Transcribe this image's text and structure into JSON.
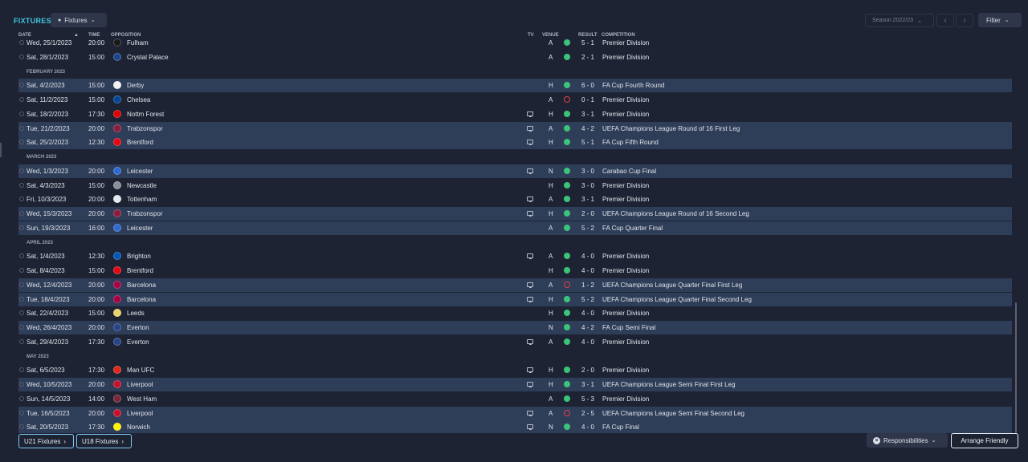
{
  "header": {
    "title": "FIXTURES",
    "view_label": "Fixtures",
    "season_label": "Season 2022/23",
    "filter_label": "Filter"
  },
  "columns": {
    "date": "DATE",
    "time": "TIME",
    "opposition": "OPPOSITION",
    "tv": "TV",
    "venue": "VENUE",
    "result": "RESULT",
    "competition": "COMPETITION"
  },
  "months": [
    "FEBRUARY 2023",
    "MARCH 2023",
    "APRIL 2023",
    "MAY 2023"
  ],
  "fixtures": [
    {
      "date": "Wed, 25/1/2023",
      "time": "20:00",
      "opposition": "Fulham",
      "tv": false,
      "venue": "A",
      "outcome": "win",
      "score": "5 - 1",
      "competition": "Premier Division",
      "crest_color": "#1b1b1b"
    },
    {
      "date": "Sat, 28/1/2023",
      "time": "15:00",
      "opposition": "Crystal Palace",
      "tv": false,
      "venue": "A",
      "outcome": "win",
      "score": "2 - 1",
      "competition": "Premier Division",
      "crest_color": "#1b458f"
    },
    {
      "date": "Sat, 4/2/2023",
      "time": "15:00",
      "opposition": "Derby",
      "tv": false,
      "venue": "H",
      "outcome": "win",
      "score": "6 - 0",
      "competition": "FA Cup Fourth Round",
      "crest_color": "#f2f2f2"
    },
    {
      "date": "Sat, 11/2/2023",
      "time": "15:00",
      "opposition": "Chelsea",
      "tv": false,
      "venue": "A",
      "outcome": "loss",
      "score": "0 - 1",
      "competition": "Premier Division",
      "crest_color": "#034694"
    },
    {
      "date": "Sat, 18/2/2023",
      "time": "17:30",
      "opposition": "Nottm Forest",
      "tv": true,
      "venue": "H",
      "outcome": "win",
      "score": "3 - 1",
      "competition": "Premier Division",
      "crest_color": "#dd0000"
    },
    {
      "date": "Tue, 21/2/2023",
      "time": "20:00",
      "opposition": "Trabzonspor",
      "tv": true,
      "venue": "A",
      "outcome": "win",
      "score": "4 - 2",
      "competition": "UEFA Champions League Round of 16 First Leg",
      "crest_color": "#8a1c3c"
    },
    {
      "date": "Sat, 25/2/2023",
      "time": "12:30",
      "opposition": "Brentford",
      "tv": true,
      "venue": "H",
      "outcome": "win",
      "score": "5 - 1",
      "competition": "FA Cup Fifth Round",
      "crest_color": "#e30613"
    },
    {
      "date": "Wed, 1/3/2023",
      "time": "20:00",
      "opposition": "Leicester",
      "tv": true,
      "venue": "N",
      "outcome": "win",
      "score": "3 - 0",
      "competition": "Carabao Cup Final",
      "crest_color": "#2f6ad0"
    },
    {
      "date": "Sat, 4/3/2023",
      "time": "15:00",
      "opposition": "Newcastle",
      "tv": false,
      "venue": "H",
      "outcome": "win",
      "score": "3 - 0",
      "competition": "Premier Division",
      "crest_color": "#8a8f99"
    },
    {
      "date": "Fri, 10/3/2023",
      "time": "20:00",
      "opposition": "Tottenham",
      "tv": true,
      "venue": "A",
      "outcome": "win",
      "score": "3 - 1",
      "competition": "Premier Division",
      "crest_color": "#e8e8f0"
    },
    {
      "date": "Wed, 15/3/2023",
      "time": "20:00",
      "opposition": "Trabzonspor",
      "tv": true,
      "venue": "H",
      "outcome": "win",
      "score": "2 - 0",
      "competition": "UEFA Champions League Round of 16 Second Leg",
      "crest_color": "#8a1c3c"
    },
    {
      "date": "Sun, 19/3/2023",
      "time": "16:00",
      "opposition": "Leicester",
      "tv": false,
      "venue": "A",
      "outcome": "win",
      "score": "5 - 2",
      "competition": "FA Cup Quarter Final",
      "crest_color": "#2f6ad0"
    },
    {
      "date": "Sat, 1/4/2023",
      "time": "12:30",
      "opposition": "Brighton",
      "tv": true,
      "venue": "A",
      "outcome": "win",
      "score": "4 - 0",
      "competition": "Premier Division",
      "crest_color": "#0057b8"
    },
    {
      "date": "Sat, 8/4/2023",
      "time": "15:00",
      "opposition": "Brentford",
      "tv": false,
      "venue": "H",
      "outcome": "win",
      "score": "4 - 0",
      "competition": "Premier Division",
      "crest_color": "#e30613"
    },
    {
      "date": "Wed, 12/4/2023",
      "time": "20:00",
      "opposition": "Barcelona",
      "tv": true,
      "venue": "A",
      "outcome": "loss",
      "score": "1 - 2",
      "competition": "UEFA Champions League Quarter Final First Leg",
      "crest_color": "#a50044"
    },
    {
      "date": "Tue, 18/4/2023",
      "time": "20:00",
      "opposition": "Barcelona",
      "tv": true,
      "venue": "H",
      "outcome": "win",
      "score": "5 - 2",
      "competition": "UEFA Champions League Quarter Final Second Leg",
      "crest_color": "#a50044"
    },
    {
      "date": "Sat, 22/4/2023",
      "time": "15:00",
      "opposition": "Leeds",
      "tv": false,
      "venue": "H",
      "outcome": "win",
      "score": "4 - 0",
      "competition": "Premier Division",
      "crest_color": "#e8d36a"
    },
    {
      "date": "Wed, 26/4/2023",
      "time": "20:00",
      "opposition": "Everton",
      "tv": false,
      "venue": "N",
      "outcome": "win",
      "score": "4 - 2",
      "competition": "FA Cup Semi Final",
      "crest_color": "#274488"
    },
    {
      "date": "Sat, 29/4/2023",
      "time": "17:30",
      "opposition": "Everton",
      "tv": true,
      "venue": "A",
      "outcome": "win",
      "score": "4 - 0",
      "competition": "Premier Division",
      "crest_color": "#274488"
    },
    {
      "date": "Sat, 6/5/2023",
      "time": "17:30",
      "opposition": "Man UFC",
      "tv": true,
      "venue": "H",
      "outcome": "win",
      "score": "2 - 0",
      "competition": "Premier Division",
      "crest_color": "#da291c"
    },
    {
      "date": "Wed, 10/5/2023",
      "time": "20:00",
      "opposition": "Liverpool",
      "tv": true,
      "venue": "H",
      "outcome": "win",
      "score": "3 - 1",
      "competition": "UEFA Champions League Semi Final First Leg",
      "crest_color": "#c8102e"
    },
    {
      "date": "Sun, 14/5/2023",
      "time": "14:00",
      "opposition": "West Ham",
      "tv": false,
      "venue": "A",
      "outcome": "win",
      "score": "5 - 3",
      "competition": "Premier Division",
      "crest_color": "#7a263a"
    },
    {
      "date": "Tue, 16/5/2023",
      "time": "20:00",
      "opposition": "Liverpool",
      "tv": true,
      "venue": "A",
      "outcome": "loss",
      "score": "2 - 5",
      "competition": "UEFA Champions League Semi Final Second Leg",
      "crest_color": "#c8102e"
    },
    {
      "date": "Sat, 20/5/2023",
      "time": "17:30",
      "opposition": "Norwich",
      "tv": true,
      "venue": "N",
      "outcome": "win",
      "score": "4 - 0",
      "competition": "FA Cup Final",
      "crest_color": "#fff200"
    }
  ],
  "footer": {
    "u21_label": "U21 Fixtures",
    "u18_label": "U18 Fixtures",
    "responsibilities_label": "Responsibilities",
    "arrange_label": "Arrange Friendly"
  },
  "colors": {
    "accent": "#3fc6e0",
    "win": "#3cc37a",
    "loss": "#e0404a",
    "background": "#1d2333"
  }
}
